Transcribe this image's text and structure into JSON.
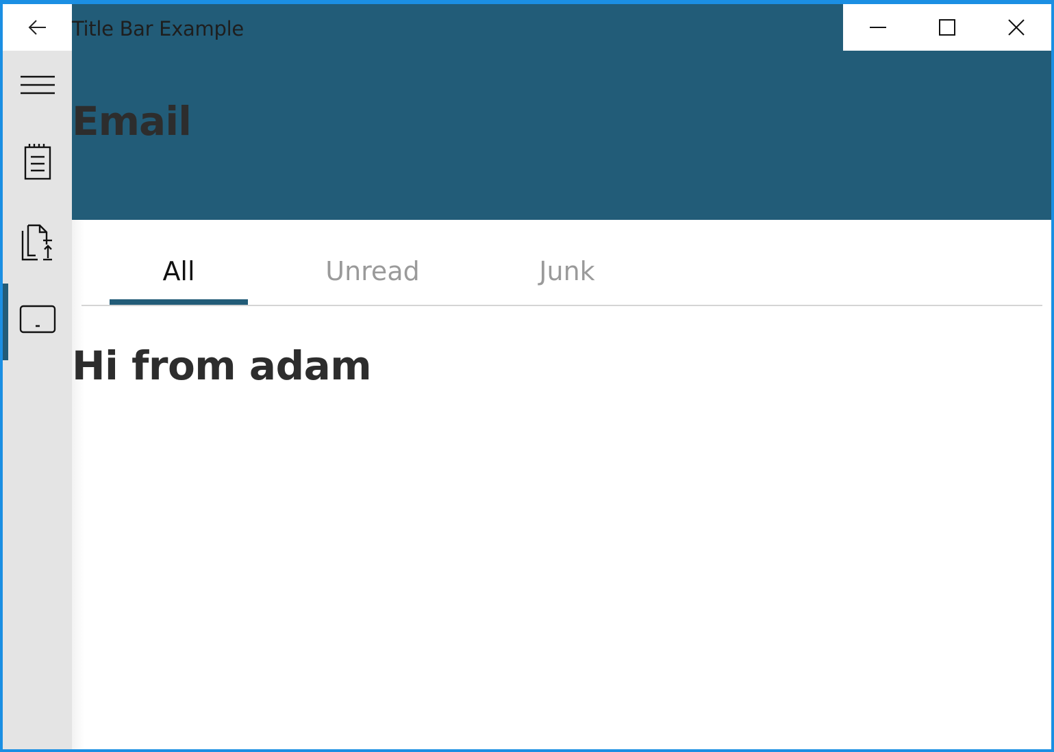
{
  "window": {
    "title": "Title Bar Example",
    "accent_color": "#1b8fe3",
    "header_color": "#225c78",
    "caption_buttons": [
      {
        "name": "minimize",
        "icon": "minimize-icon"
      },
      {
        "name": "maximize",
        "icon": "maximize-icon"
      },
      {
        "name": "close",
        "icon": "close-icon"
      }
    ]
  },
  "back_button": {
    "icon": "back-arrow-icon"
  },
  "header": {
    "title": "Email"
  },
  "nav": {
    "items": [
      {
        "icon": "hamburger-menu-icon"
      },
      {
        "icon": "notepad-icon"
      },
      {
        "icon": "document-upload-icon"
      },
      {
        "icon": "tablet-icon",
        "selected": true
      }
    ]
  },
  "tabs": [
    {
      "label": "All",
      "selected": true
    },
    {
      "label": "Unread",
      "selected": false
    },
    {
      "label": "Junk",
      "selected": false
    }
  ],
  "content": {
    "message": "Hi from adam"
  }
}
